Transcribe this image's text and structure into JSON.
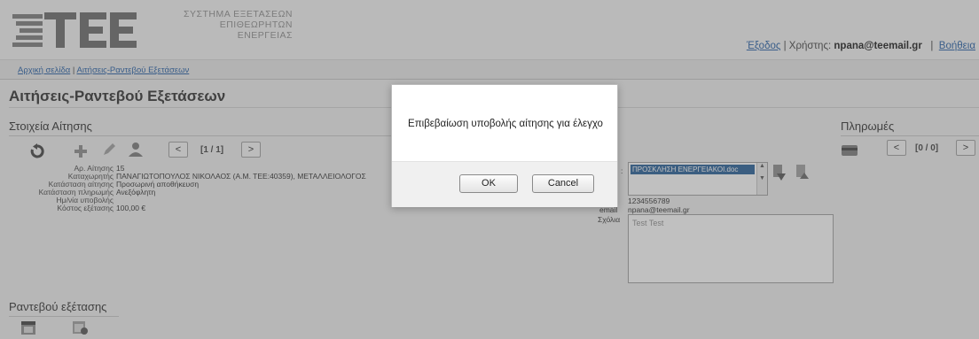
{
  "header": {
    "system_title_lines": [
      "ΣΥΣΤΗΜΑ ΕΞΕΤΑΣΕΩΝ",
      "ΕΠΙΘΕΩΡΗΤΩΝ",
      "ΕΝΕΡΓΕΙΑΣ"
    ],
    "logout_link": "Έξοδος",
    "user_label": "Χρήστης:",
    "user_email": "npana@teemail.gr",
    "help_link": "Βοήθεια"
  },
  "breadcrumb": {
    "home": "Αρχική σελίδα",
    "current": "Αιτήσεις-Ραντεβού Εξετάσεων"
  },
  "page_title": "Αιτήσεις-Ραντεβού Εξετάσεων",
  "application_section": {
    "title": "Στοιχεία Αίτησης",
    "pager": {
      "prev": "<",
      "text": "[1 / 1]",
      "next": ">"
    },
    "fields": [
      {
        "label": "Αρ. Αίτησης",
        "value": "15"
      },
      {
        "label": "Καταχωρητής",
        "value": "ΠΑΝΑΓΙΩΤΟΠΟΥΛΟΣ ΝΙΚΟΛΑΟΣ (Α.Μ. ΤΕΕ:40359), ΜΕΤΑΛΛΕΙΟΛΟΓΟΣ"
      },
      {
        "label": "Κατάσταση αίτησης",
        "value": "Προσωρινή αποθήκευση"
      },
      {
        "label": "Κατάσταση πληρωμής",
        "value": "Ανεξόφλητη"
      },
      {
        "label": "Ημ/νία υποβολής",
        "value": ""
      },
      {
        "label": "Κόστος εξέτασης",
        "value": "100,00 €"
      }
    ],
    "attachment_name": "ΠΡΟΣΚΛΗΣΗ ΕΝΕΡΓΕΙΑΚΟΙ.doc",
    "phone": "1234556789",
    "email_label": "email",
    "email_value": "npana@teemail.gr",
    "comments_label": "Σχόλια",
    "comments_value": "Test Test"
  },
  "payments_section": {
    "title": "Πληρωμές",
    "pager": {
      "prev": "<",
      "text": "[0 / 0]",
      "next": ">"
    }
  },
  "appointment_section": {
    "title": "Ραντεβού εξέτασης"
  },
  "dialog": {
    "message": "Επιβεβαίωση υποβολής αίτησης για έλεγχο",
    "ok_label": "OK",
    "cancel_label": "Cancel"
  }
}
